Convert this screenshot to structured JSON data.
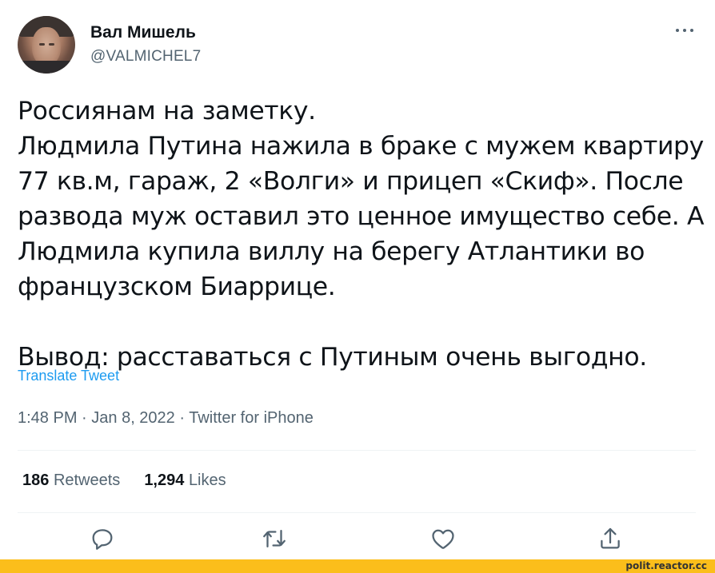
{
  "author": {
    "name": "Вал Мишель",
    "handle": "@VALMICHEL7"
  },
  "tweet": {
    "lines": [
      "Россиянам на заметку.",
      "Людмила Путина нажила в браке с мужем квартиру",
      "77 кв.м, гараж, 2 «Волги» и прицеп «Скиф». После",
      "развода муж оставил это ценное имущество себе. А",
      "Людмила купила виллу на берегу Атлантики во",
      "французском Биаррице."
    ],
    "conclusion": "Вывод: расставаться с Путиным очень выгодно."
  },
  "translate_label": "Translate Tweet",
  "meta": {
    "time": "1:48 PM",
    "date": "Jan 8, 2022",
    "source": "Twitter for iPhone",
    "separator": " · "
  },
  "stats": {
    "retweets_count": "186",
    "retweets_label": "Retweets",
    "likes_count": "1,294",
    "likes_label": "Likes"
  },
  "icons": [
    "more-icon",
    "reply-icon",
    "retweet-icon",
    "like-icon",
    "share-icon"
  ],
  "watermark": "polit.reactor.cc",
  "colors": {
    "link": "#1d9bf0",
    "secondary": "#536471",
    "text": "#0f1419",
    "watermark_bar": "#fbbe1b"
  }
}
